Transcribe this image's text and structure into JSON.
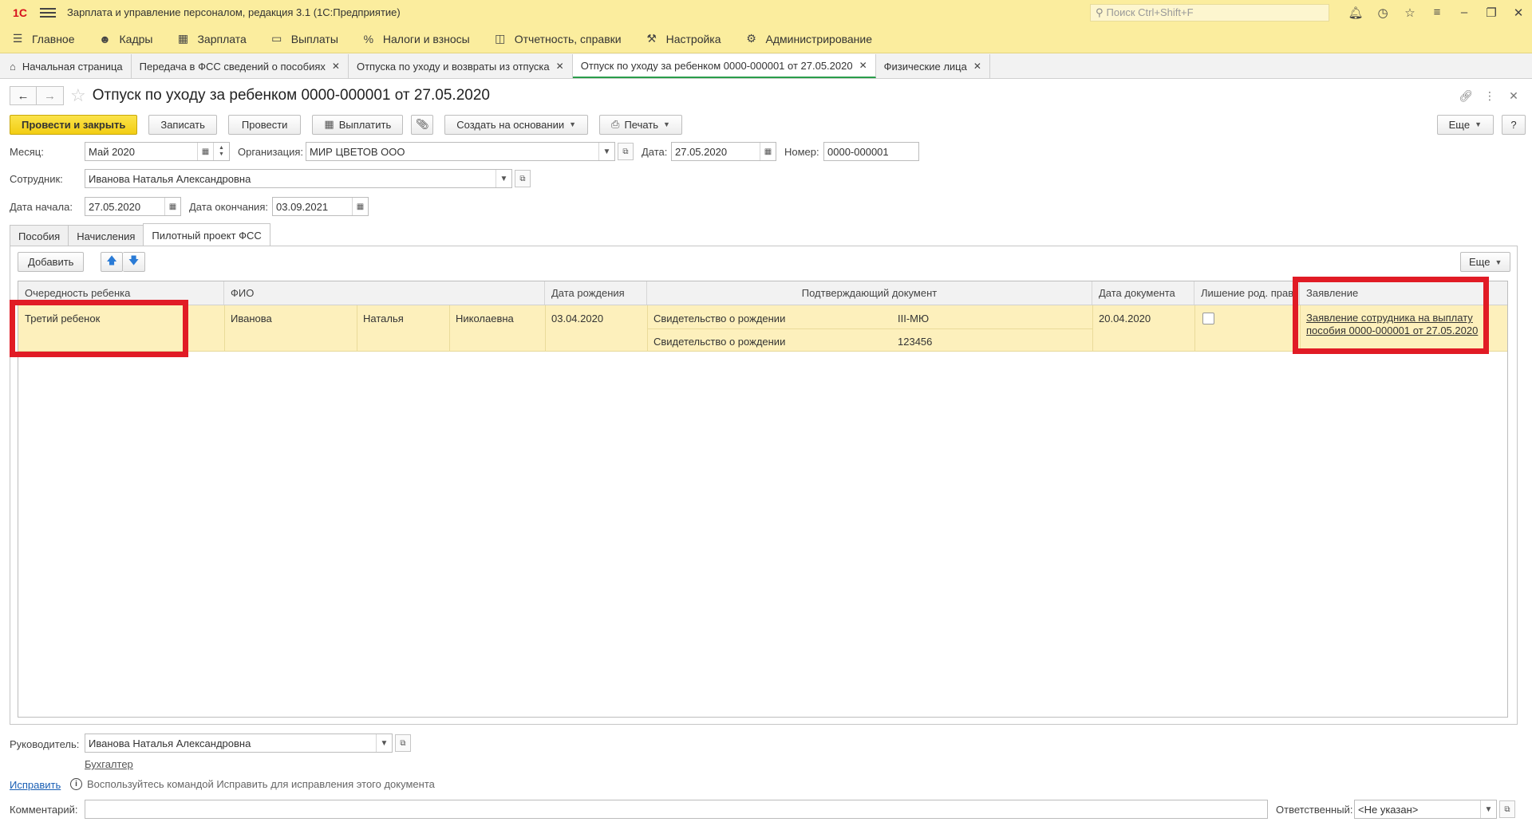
{
  "app": {
    "logo": "1С",
    "title": "Зарплата и управление персоналом, редакция 3.1  (1С:Предприятие)",
    "search_placeholder": "Поиск Ctrl+Shift+F"
  },
  "sections": [
    {
      "label": "Главное",
      "icon": "menu-icon"
    },
    {
      "label": "Кадры",
      "icon": "people-icon"
    },
    {
      "label": "Зарплата",
      "icon": "calculator-icon"
    },
    {
      "label": "Выплаты",
      "icon": "wallet-icon"
    },
    {
      "label": "Налоги и взносы",
      "icon": "percent-icon"
    },
    {
      "label": "Отчетность, справки",
      "icon": "report-icon"
    },
    {
      "label": "Настройка",
      "icon": "wrench-icon"
    },
    {
      "label": "Администрирование",
      "icon": "gear-icon"
    }
  ],
  "window_tabs": [
    {
      "label": "Начальная страница"
    },
    {
      "label": "Передача в ФСС сведений о пособиях"
    },
    {
      "label": "Отпуска по уходу и возвраты из отпуска"
    },
    {
      "label": "Отпуск по уходу за ребенком 0000-000001 от 27.05.2020"
    },
    {
      "label": "Физические лица"
    }
  ],
  "document": {
    "title": "Отпуск по уходу за ребенком 0000-000001 от 27.05.2020"
  },
  "commands": {
    "post_close": "Провести и закрыть",
    "save": "Записать",
    "post": "Провести",
    "pay": "Выплатить",
    "create_based": "Создать на основании",
    "print": "Печать",
    "more": "Еще",
    "help": "?"
  },
  "form": {
    "month_label": "Месяц:",
    "month_value": "Май 2020",
    "org_label": "Организация:",
    "org_value": "МИР ЦВЕТОВ ООО",
    "date_label": "Дата:",
    "date_value": "27.05.2020",
    "number_label": "Номер:",
    "number_value": "0000-000001",
    "employee_label": "Сотрудник:",
    "employee_value": "Иванова Наталья Александровна",
    "start_label": "Дата начала:",
    "start_value": "27.05.2020",
    "end_label": "Дата окончания:",
    "end_value": "03.09.2021"
  },
  "inner_tabs": [
    "Пособия",
    "Начисления",
    "Пилотный проект ФСС"
  ],
  "table_toolbar": {
    "add": "Добавить",
    "more": "Еще"
  },
  "table": {
    "columns": [
      "Очередность ребенка",
      "ФИО",
      "Дата рождения",
      "Подтверждающий документ",
      "Дата документа",
      "Лишение род. прав",
      "Заявление"
    ],
    "rows": [
      {
        "order": "Третий ребенок",
        "last_name": "Иванова",
        "first_name": "Наталья",
        "patronymic": "Николаевна",
        "birth_date": "03.04.2020",
        "doc1_type": "Свидетельство о рождении",
        "doc1_value": "III-МЮ",
        "doc2_type": "Свидетельство о рождении",
        "doc2_value": "123456",
        "doc_date": "20.04.2020",
        "application_line1": "Заявление сотрудника на выплату",
        "application_line2": "пособия 0000-000001 от 27.05.2020"
      }
    ]
  },
  "footer": {
    "head_label": "Руководитель:",
    "head_value": "Иванова Наталья Александровна",
    "accountant_link": "Бухгалтер",
    "fix_link": "Исправить",
    "fix_hint": "Воспользуйтесь командой Исправить для исправления этого документа",
    "comment_label": "Комментарий:",
    "comment_value": "",
    "responsible_label": "Ответственный:",
    "responsible_value": "<Не указан>"
  },
  "colors": {
    "header_bg": "#fbed9e",
    "primary_button": "#f4d21c",
    "row_highlight": "#fdf0bc",
    "annotation_red": "#e11b25"
  }
}
